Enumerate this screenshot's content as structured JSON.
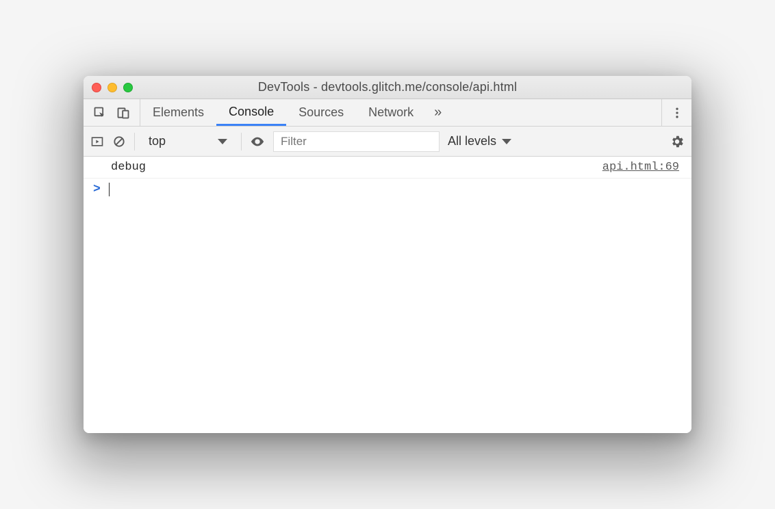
{
  "window": {
    "title": "DevTools - devtools.glitch.me/console/api.html"
  },
  "tabs": {
    "items": [
      {
        "label": "Elements",
        "active": false
      },
      {
        "label": "Console",
        "active": true
      },
      {
        "label": "Sources",
        "active": false
      },
      {
        "label": "Network",
        "active": false
      }
    ],
    "more_glyph": "»"
  },
  "filterbar": {
    "context": "top",
    "filter_placeholder": "Filter",
    "levels_label": "All levels"
  },
  "console": {
    "entries": [
      {
        "message": "debug",
        "source": "api.html:69"
      }
    ],
    "prompt": ">"
  }
}
